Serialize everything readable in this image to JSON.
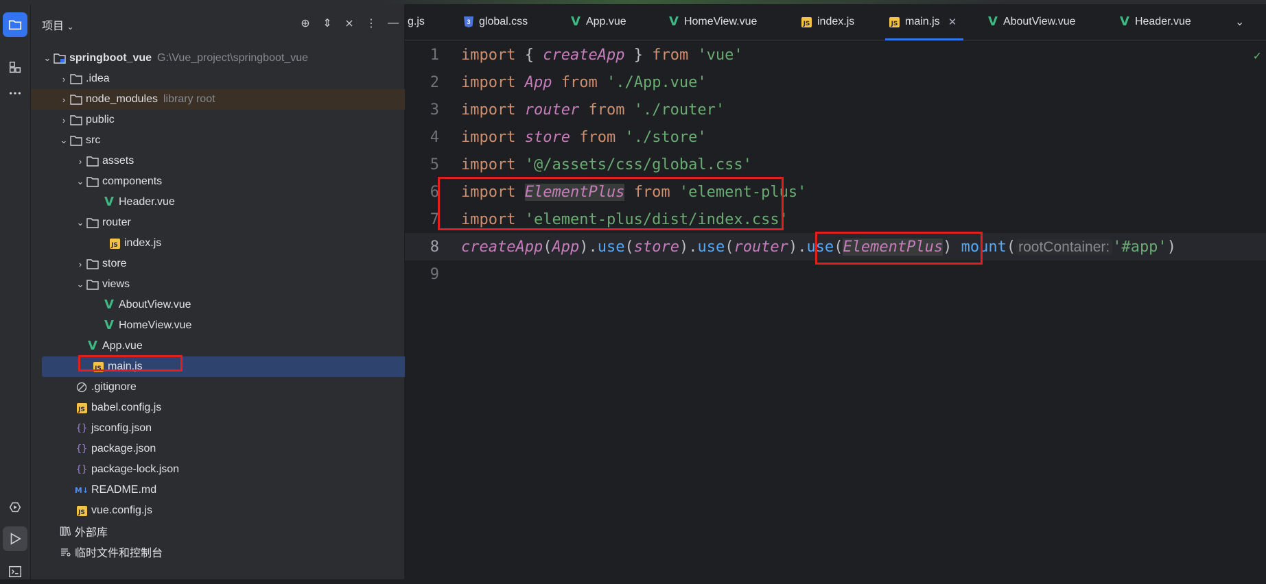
{
  "project_panel": {
    "title": "项目",
    "tree": [
      {
        "label": "springboot_vue",
        "hint": "G:\\Vue_project\\springboot_vue",
        "icon": "module-folder-icon"
      },
      {
        "label": ".idea",
        "icon": "folder-icon"
      },
      {
        "label": "node_modules",
        "hint": "library root",
        "icon": "folder-icon"
      },
      {
        "label": "public",
        "icon": "folder-icon"
      },
      {
        "label": "src",
        "icon": "folder-icon"
      },
      {
        "label": "assets",
        "icon": "folder-icon"
      },
      {
        "label": "components",
        "icon": "folder-icon"
      },
      {
        "label": "Header.vue",
        "icon": "vue-file-icon"
      },
      {
        "label": "router",
        "icon": "folder-icon"
      },
      {
        "label": "index.js",
        "icon": "js-file-icon"
      },
      {
        "label": "store",
        "icon": "folder-icon"
      },
      {
        "label": "views",
        "icon": "folder-icon"
      },
      {
        "label": "AboutView.vue",
        "icon": "vue-file-icon"
      },
      {
        "label": "HomeView.vue",
        "icon": "vue-file-icon"
      },
      {
        "label": "App.vue",
        "icon": "vue-file-icon"
      },
      {
        "label": "main.js",
        "icon": "js-file-icon"
      },
      {
        "label": ".gitignore",
        "icon": "ignore-file-icon"
      },
      {
        "label": "babel.config.js",
        "icon": "js-file-icon"
      },
      {
        "label": "jsconfig.json",
        "icon": "json-file-icon"
      },
      {
        "label": "package.json",
        "icon": "json-file-icon"
      },
      {
        "label": "package-lock.json",
        "icon": "json-file-icon"
      },
      {
        "label": "README.md",
        "icon": "markdown-file-icon"
      },
      {
        "label": "vue.config.js",
        "icon": "js-file-icon"
      },
      {
        "label": "外部库",
        "icon": "library-icon"
      },
      {
        "label": "临时文件和控制台",
        "icon": "scratches-icon"
      }
    ]
  },
  "tabs": [
    {
      "label": "g.js",
      "icon": ""
    },
    {
      "label": "global.css",
      "icon": "css-file-icon"
    },
    {
      "label": "App.vue",
      "icon": "vue-file-icon"
    },
    {
      "label": "HomeView.vue",
      "icon": "vue-file-icon"
    },
    {
      "label": "index.js",
      "icon": "js-file-icon"
    },
    {
      "label": "main.js",
      "icon": "js-file-icon",
      "active": true
    },
    {
      "label": "AboutView.vue",
      "icon": "vue-file-icon"
    },
    {
      "label": "Header.vue",
      "icon": "vue-file-icon"
    }
  ],
  "editor": {
    "line_numbers": [
      "1",
      "2",
      "3",
      "4",
      "5",
      "6",
      "7",
      "8",
      "9"
    ],
    "current_line": 8,
    "code": {
      "l1": [
        "import",
        " { ",
        "createApp",
        " } ",
        "from",
        " ",
        "'vue'"
      ],
      "l2": [
        "import",
        " ",
        "App",
        " ",
        "from",
        " ",
        "'./App.vue'"
      ],
      "l3": [
        "import",
        " ",
        "router",
        " ",
        "from",
        " ",
        "'./router'"
      ],
      "l4": [
        "import",
        " ",
        "store",
        " ",
        "from",
        " ",
        "'./store'"
      ],
      "l5": [
        "import",
        " ",
        "'@/assets/css/global.css'"
      ],
      "l6": [
        "import",
        " ",
        "ElementPlus",
        " ",
        "from",
        " ",
        "'element-plus'"
      ],
      "l7": [
        "import",
        " ",
        "'element-plus/dist/index.css'"
      ],
      "l8": [
        "createApp",
        "(",
        "App",
        ").",
        "use",
        "(",
        "store",
        ").",
        "use",
        "(",
        "router",
        ")",
        ".",
        "use",
        "(",
        "ElementPlus",
        ")",
        " ",
        "mount",
        "(",
        "rootContainer:",
        "'#app'",
        ")"
      ]
    }
  },
  "colors": {
    "accent": "#3574f0",
    "highlight_box": "#e0201c",
    "keyword": "#cf8e6d",
    "string": "#6aab73",
    "identifier": "#c77dbb",
    "method": "#56a8f5"
  }
}
